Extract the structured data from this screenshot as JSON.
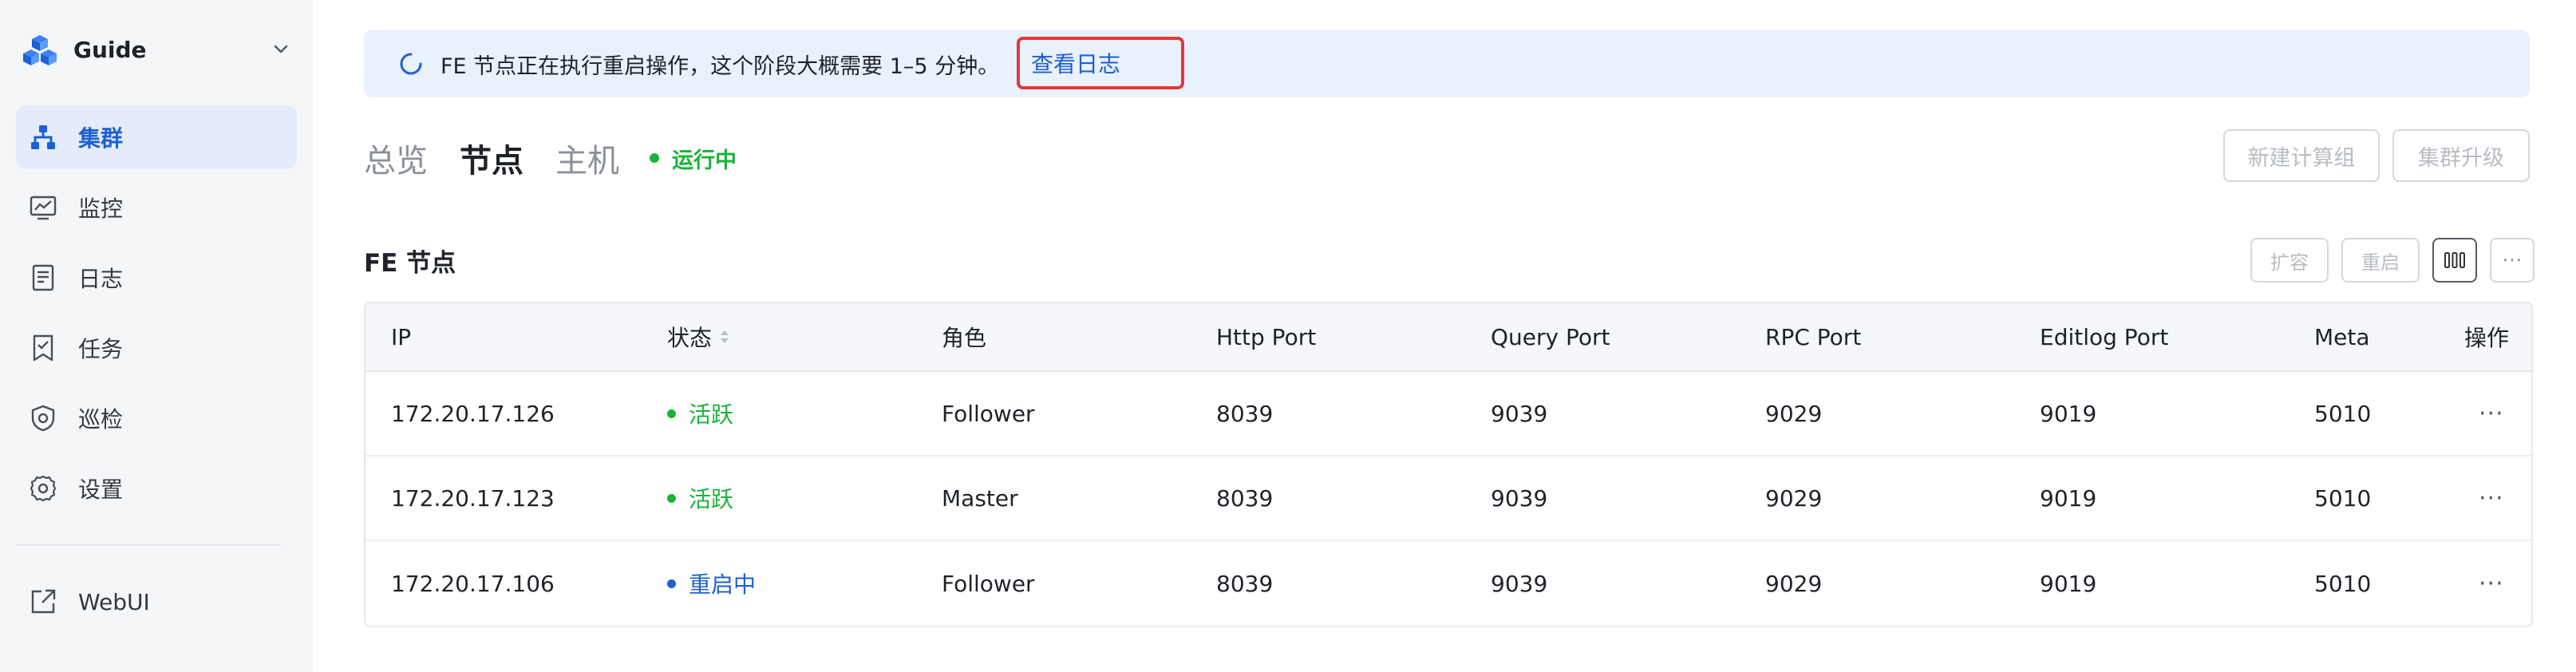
{
  "sidebar": {
    "brand": "Guide",
    "items": [
      {
        "label": "集群",
        "icon": "cluster-icon",
        "active": true
      },
      {
        "label": "监控",
        "icon": "monitor-icon",
        "active": false
      },
      {
        "label": "日志",
        "icon": "log-icon",
        "active": false
      },
      {
        "label": "任务",
        "icon": "task-icon",
        "active": false
      },
      {
        "label": "巡检",
        "icon": "inspection-icon",
        "active": false
      },
      {
        "label": "设置",
        "icon": "settings-icon",
        "active": false
      }
    ],
    "footer_item": {
      "label": "WebUI",
      "icon": "external-link-icon"
    }
  },
  "banner": {
    "message": "FE 节点正在执行重启操作，这个阶段大概需要 1–5 分钟。",
    "link": "查看日志"
  },
  "tabs": [
    {
      "label": "总览",
      "active": false
    },
    {
      "label": "节点",
      "active": true
    },
    {
      "label": "主机",
      "active": false
    }
  ],
  "cluster_status": "运行中",
  "header_buttons": {
    "new_compute_group": "新建计算组",
    "upgrade_cluster": "集群升级"
  },
  "section": {
    "title": "FE 节点",
    "buttons": {
      "scale": "扩容",
      "restart": "重启",
      "more": "···"
    }
  },
  "table": {
    "columns": [
      "IP",
      "状态",
      "角色",
      "Http Port",
      "Query Port",
      "RPC Port",
      "Editlog Port",
      "Meta",
      "操作"
    ],
    "rows": [
      {
        "ip": "172.20.17.126",
        "status": "活跃",
        "status_color": "#19b43a",
        "role": "Follower",
        "http": "8039",
        "query": "9039",
        "rpc": "9029",
        "editlog": "9019",
        "meta": "5010",
        "action": "···"
      },
      {
        "ip": "172.20.17.123",
        "status": "活跃",
        "status_color": "#19b43a",
        "role": "Master",
        "http": "8039",
        "query": "9039",
        "rpc": "9029",
        "editlog": "9019",
        "meta": "5010",
        "action": "···"
      },
      {
        "ip": "172.20.17.106",
        "status": "重启中",
        "status_color": "#1d5fd6",
        "role": "Follower",
        "http": "8039",
        "query": "9039",
        "rpc": "9029",
        "editlog": "9019",
        "meta": "5010",
        "action": "···"
      }
    ]
  },
  "colors": {
    "accent": "#1d5fd6",
    "success": "#19b43a",
    "highlight_border": "#e03a3a"
  }
}
